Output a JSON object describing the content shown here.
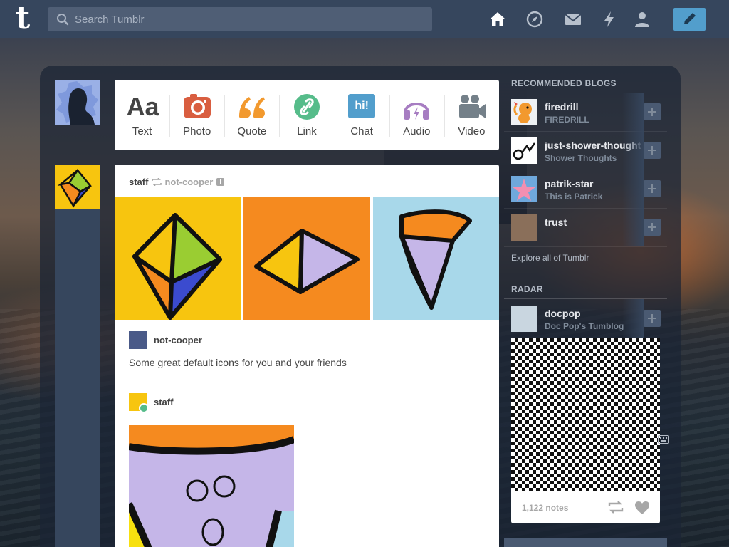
{
  "topbar": {
    "logo": "t",
    "search_placeholder": "Search Tumblr",
    "icons": [
      "home-icon",
      "explore-icon",
      "inbox-icon",
      "activity-icon",
      "account-icon",
      "compose-icon"
    ]
  },
  "post_types": [
    {
      "label": "Text",
      "icon": "text-icon",
      "color": "#444444",
      "glyph": "Aa"
    },
    {
      "label": "Photo",
      "icon": "camera-icon",
      "color": "#d95e40"
    },
    {
      "label": "Quote",
      "icon": "quote-icon",
      "color": "#f2992e"
    },
    {
      "label": "Link",
      "icon": "link-icon",
      "color": "#56bc8a"
    },
    {
      "label": "Chat",
      "icon": "chat-icon",
      "color": "#529ecc",
      "glyph": "hi!"
    },
    {
      "label": "Audio",
      "icon": "headphones-icon",
      "color": "#a77dc2"
    },
    {
      "label": "Video",
      "icon": "video-camera-icon",
      "color": "#748089"
    }
  ],
  "post": {
    "blog": "staff",
    "reblogged_from": "not-cooper",
    "trail": [
      {
        "name": "not-cooper",
        "text": "Some great default icons for you and your friends"
      },
      {
        "name": "staff"
      }
    ],
    "photos": [
      "yellow-kite-icon",
      "orange-diamond-icon",
      "blue-cone-icon"
    ]
  },
  "sidebar": {
    "recommended_title": "Recommended Blogs",
    "recommended": [
      {
        "name": "firedrill",
        "subtitle": "FIREDRILL"
      },
      {
        "name": "just-shower-thoughts",
        "subtitle": "Shower Thoughts"
      },
      {
        "name": "patrik-star",
        "subtitle": "This is Patrick"
      },
      {
        "name": "trust",
        "subtitle": ""
      }
    ],
    "explore_link": "Explore all of Tumblr",
    "radar_title": "Radar",
    "radar": {
      "name": "docpop",
      "subtitle": "Doc Pop's Tumblog",
      "notes": "1,122 notes"
    }
  },
  "colors": {
    "navy": "#36465d",
    "accent_blue": "#529ecc",
    "text": "#444444",
    "muted": "#a7a7a7"
  }
}
